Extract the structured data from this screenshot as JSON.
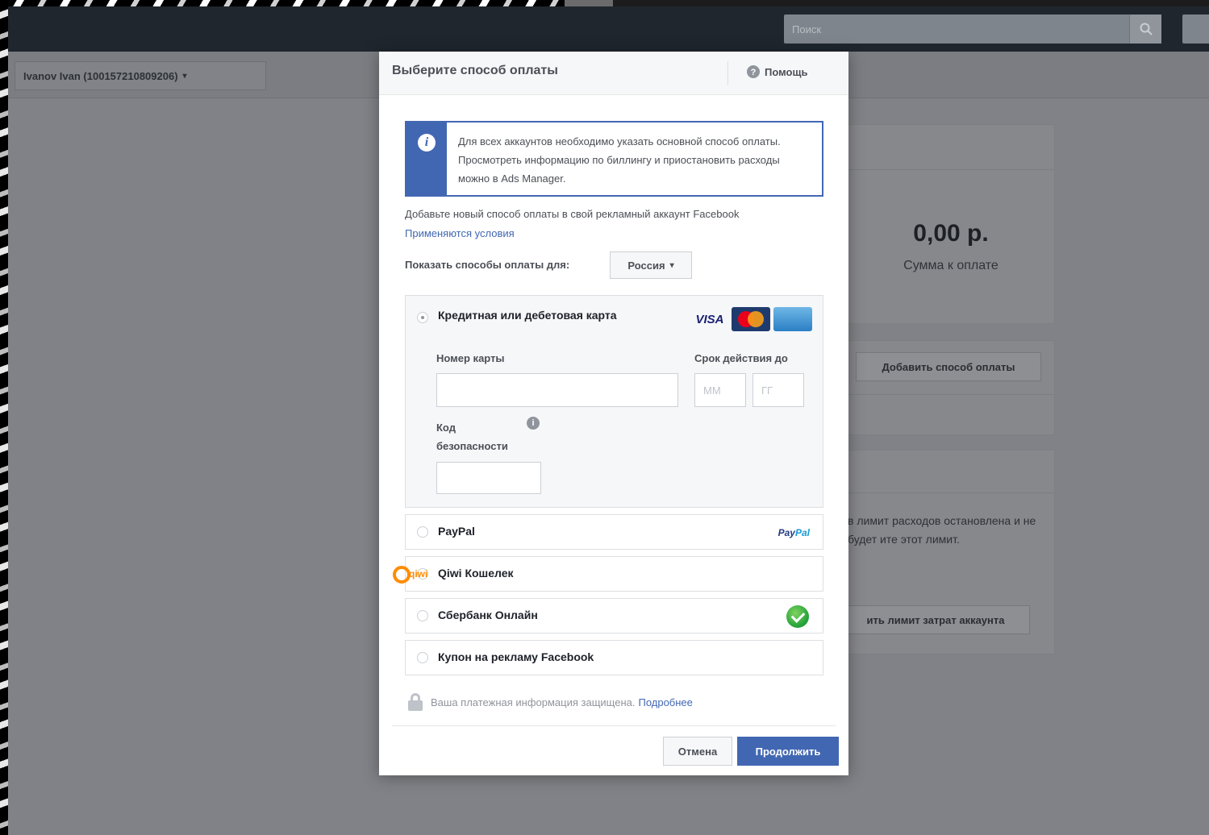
{
  "topbar": {
    "search_placeholder": "Поиск",
    "search_icon": "search-icon"
  },
  "account": {
    "selected": "Ivanov Ivan (100157210809206)",
    "caret": "▾"
  },
  "summary": {
    "amount": "0,00 р.",
    "amount_label": "Сумма к оплате",
    "add_method_button": "Добавить способ оплаты",
    "limit_text": "в лимит расходов остановлена и не будет ите этот лимит.",
    "limit_button": "ить лимит затрат аккаунта"
  },
  "modal": {
    "title": "Выберите способ оплаты",
    "help_label": "Помощь",
    "info_text": "Для всех аккаунтов необходимо указать основной способ оплаты. Просмотреть информацию по биллингу и приостановить расходы можно в Ads Manager.",
    "add_new_text": "Добавьте новый способ оплаты в свой рекламный аккаунт Facebook",
    "terms_link": "Применяются условия",
    "country_label": "Показать способы оплаты для:",
    "country_value": "Россия",
    "country_caret": "▾",
    "card": {
      "label": "Кредитная или дебетовая карта",
      "visa_text": "VISA",
      "number_label": "Номер карты",
      "expiry_label": "Срок действия до",
      "mm_placeholder": "ММ",
      "yy_placeholder": "ГГ",
      "cvv_label": "Код безопасности",
      "cvv_info": "i"
    },
    "options": {
      "paypal": "PayPal",
      "qiwi": "Qiwi Кошелек",
      "sber": "Сбербанк Онлайн",
      "coupon": "Купон на рекламу Facebook"
    },
    "logos": {
      "paypal_a": "Pay",
      "paypal_b": "Pal",
      "qiwi": "qiwi"
    },
    "secure_text": "Ваша платежная информация защищена.",
    "secure_more": "Подробнее",
    "cancel_button": "Отмена",
    "continue_button": "Продолжить"
  },
  "colors": {
    "primary": "#4267b2",
    "topbar": "#1f262e",
    "overlay_bg": "#808287"
  }
}
